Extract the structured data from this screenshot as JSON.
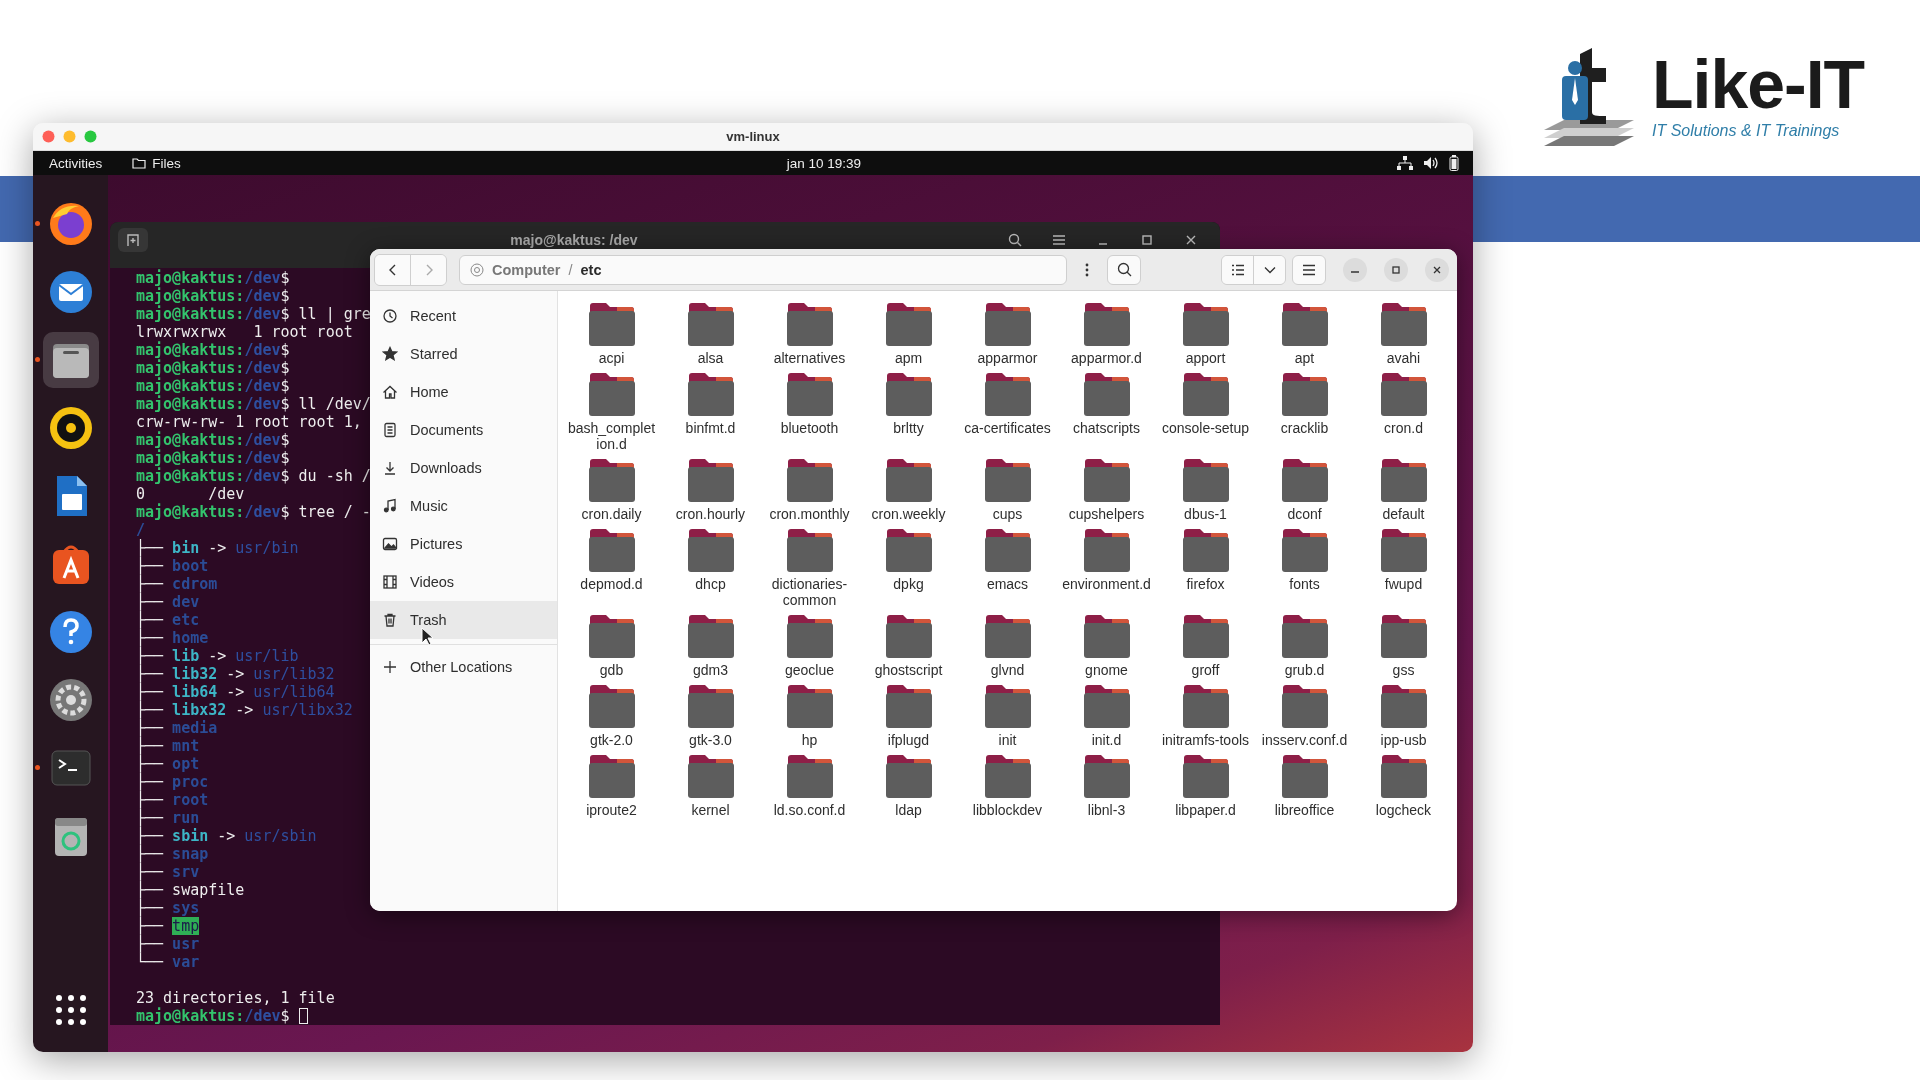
{
  "logo": {
    "name": "Like-IT",
    "tagline": "IT Solutions & IT Trainings"
  },
  "vm_window": {
    "title": "vm-linux"
  },
  "top_bar": {
    "activities": "Activities",
    "app_menu": "Files",
    "clock": "jan 10  19:39"
  },
  "dock": [
    {
      "kind": "firefox",
      "running": true,
      "focused": false
    },
    {
      "kind": "mail",
      "running": false,
      "focused": false
    },
    {
      "kind": "files",
      "running": true,
      "focused": true
    },
    {
      "kind": "music",
      "running": false,
      "focused": false
    },
    {
      "kind": "writer",
      "running": false,
      "focused": false
    },
    {
      "kind": "software",
      "running": false,
      "focused": false
    },
    {
      "kind": "help",
      "running": false,
      "focused": false
    },
    {
      "kind": "settings",
      "running": false,
      "focused": false
    },
    {
      "kind": "terminal",
      "running": true,
      "focused": false
    },
    {
      "kind": "trash",
      "running": false,
      "focused": false
    },
    {
      "kind": "apps",
      "running": false,
      "focused": false
    }
  ],
  "terminal": {
    "title": "majo@kaktus: /dev",
    "lines": [
      {
        "kind": "prompt",
        "user": "majo@kaktus:",
        "path": "/dev",
        "command": "$"
      },
      {
        "kind": "prompt",
        "user": "majo@kaktus:",
        "path": "/dev",
        "command": "$"
      },
      {
        "kind": "prompt",
        "user": "majo@kaktus:",
        "path": "/dev",
        "command": "$ ll | gre"
      },
      {
        "kind": "output",
        "text": "lrwxrwxrwx   1 root root"
      },
      {
        "kind": "prompt",
        "user": "majo@kaktus:",
        "path": "/dev",
        "command": "$"
      },
      {
        "kind": "prompt",
        "user": "majo@kaktus:",
        "path": "/dev",
        "command": "$"
      },
      {
        "kind": "prompt",
        "user": "majo@kaktus:",
        "path": "/dev",
        "command": "$"
      },
      {
        "kind": "prompt",
        "user": "majo@kaktus:",
        "path": "/dev",
        "command": "$ ll /dev/"
      },
      {
        "kind": "output",
        "text": "crw-rw-rw- 1 root root 1,"
      },
      {
        "kind": "prompt",
        "user": "majo@kaktus:",
        "path": "/dev",
        "command": "$"
      },
      {
        "kind": "prompt",
        "user": "majo@kaktus:",
        "path": "/dev",
        "command": "$"
      },
      {
        "kind": "prompt",
        "user": "majo@kaktus:",
        "path": "/dev",
        "command": "$ du -sh /"
      },
      {
        "kind": "output",
        "text": "0       /dev"
      },
      {
        "kind": "prompt",
        "user": "majo@kaktus:",
        "path": "/dev",
        "command": "$ tree / -"
      },
      {
        "kind": "dir",
        "name": "/"
      },
      {
        "kind": "link",
        "branch": "├──",
        "name": "bin",
        "arrow": "->",
        "target": "usr/bin"
      },
      {
        "kind": "dir",
        "branch": "├──",
        "name": "boot"
      },
      {
        "kind": "dir",
        "branch": "├──",
        "name": "cdrom"
      },
      {
        "kind": "dir",
        "branch": "├──",
        "name": "dev"
      },
      {
        "kind": "dir",
        "branch": "├──",
        "name": "etc"
      },
      {
        "kind": "dir",
        "branch": "├──",
        "name": "home"
      },
      {
        "kind": "link",
        "branch": "├──",
        "name": "lib",
        "arrow": "->",
        "target": "usr/lib"
      },
      {
        "kind": "link",
        "branch": "├──",
        "name": "lib32",
        "arrow": "->",
        "target": "usr/lib32"
      },
      {
        "kind": "link",
        "branch": "├──",
        "name": "lib64",
        "arrow": "->",
        "target": "usr/lib64"
      },
      {
        "kind": "link",
        "branch": "├──",
        "name": "libx32",
        "arrow": "->",
        "target": "usr/libx32"
      },
      {
        "kind": "dir",
        "branch": "├──",
        "name": "media"
      },
      {
        "kind": "dir",
        "branch": "├──",
        "name": "mnt"
      },
      {
        "kind": "dir",
        "branch": "├──",
        "name": "opt"
      },
      {
        "kind": "dir",
        "branch": "├──",
        "name": "proc"
      },
      {
        "kind": "dir",
        "branch": "├──",
        "name": "root"
      },
      {
        "kind": "dir",
        "branch": "├──",
        "name": "run"
      },
      {
        "kind": "link",
        "branch": "├──",
        "name": "sbin",
        "arrow": "->",
        "target": "usr/sbin"
      },
      {
        "kind": "dir",
        "branch": "├──",
        "name": "snap"
      },
      {
        "kind": "dir",
        "branch": "├──",
        "name": "srv"
      },
      {
        "kind": "file",
        "branch": "├──",
        "name": "swapfile"
      },
      {
        "kind": "dir",
        "branch": "├──",
        "name": "sys"
      },
      {
        "kind": "sticky",
        "branch": "├──",
        "name": "tmp"
      },
      {
        "kind": "dir",
        "branch": "├──",
        "name": "usr"
      },
      {
        "kind": "dir",
        "branch": "└──",
        "name": "var"
      },
      {
        "kind": "blank"
      },
      {
        "kind": "output",
        "text": "23 directories, 1 file"
      },
      {
        "kind": "prompt",
        "user": "majo@kaktus:",
        "path": "/dev",
        "command": "$",
        "cursor": true
      }
    ]
  },
  "file_manager": {
    "back_disabled": false,
    "forward_disabled": true,
    "path": [
      {
        "label": "Computer",
        "current": false
      },
      {
        "label": "etc",
        "current": true
      }
    ],
    "separator": "/",
    "sidebar": [
      {
        "kind": "recent",
        "label": "Recent",
        "hovered": false
      },
      {
        "kind": "star",
        "label": "Starred",
        "hovered": false
      },
      {
        "kind": "home",
        "label": "Home",
        "hovered": false
      },
      {
        "kind": "document",
        "label": "Documents",
        "hovered": false
      },
      {
        "kind": "download",
        "label": "Downloads",
        "hovered": false
      },
      {
        "kind": "music",
        "label": "Music",
        "hovered": false
      },
      {
        "kind": "picture",
        "label": "Pictures",
        "hovered": false
      },
      {
        "kind": "film",
        "label": "Videos",
        "hovered": false
      },
      {
        "kind": "trash",
        "label": "Trash",
        "hovered": true
      }
    ],
    "other_locations": "Other Locations",
    "folders": [
      "acpi",
      "alsa",
      "alternatives",
      "apm",
      "apparmor",
      "apparmor.d",
      "apport",
      "apt",
      "avahi",
      "bash_completion.d",
      "binfmt.d",
      "bluetooth",
      "brltty",
      "ca-certificates",
      "chatscripts",
      "console-setup",
      "cracklib",
      "cron.d",
      "cron.daily",
      "cron.hourly",
      "cron.monthly",
      "cron.weekly",
      "cups",
      "cupshelpers",
      "dbus-1",
      "dconf",
      "default",
      "depmod.d",
      "dhcp",
      "dictionaries-common",
      "dpkg",
      "emacs",
      "environment.d",
      "firefox",
      "fonts",
      "fwupd",
      "gdb",
      "gdm3",
      "geoclue",
      "ghostscript",
      "glvnd",
      "gnome",
      "groff",
      "grub.d",
      "gss",
      "gtk-2.0",
      "gtk-3.0",
      "hp",
      "ifplugd",
      "init",
      "init.d",
      "initramfs-tools",
      "insserv.conf.d",
      "ipp-usb",
      "iproute2",
      "kernel",
      "ld.so.conf.d",
      "ldap",
      "libblockdev",
      "libnl-3",
      "libpaper.d",
      "libreoffice",
      "logcheck"
    ]
  }
}
